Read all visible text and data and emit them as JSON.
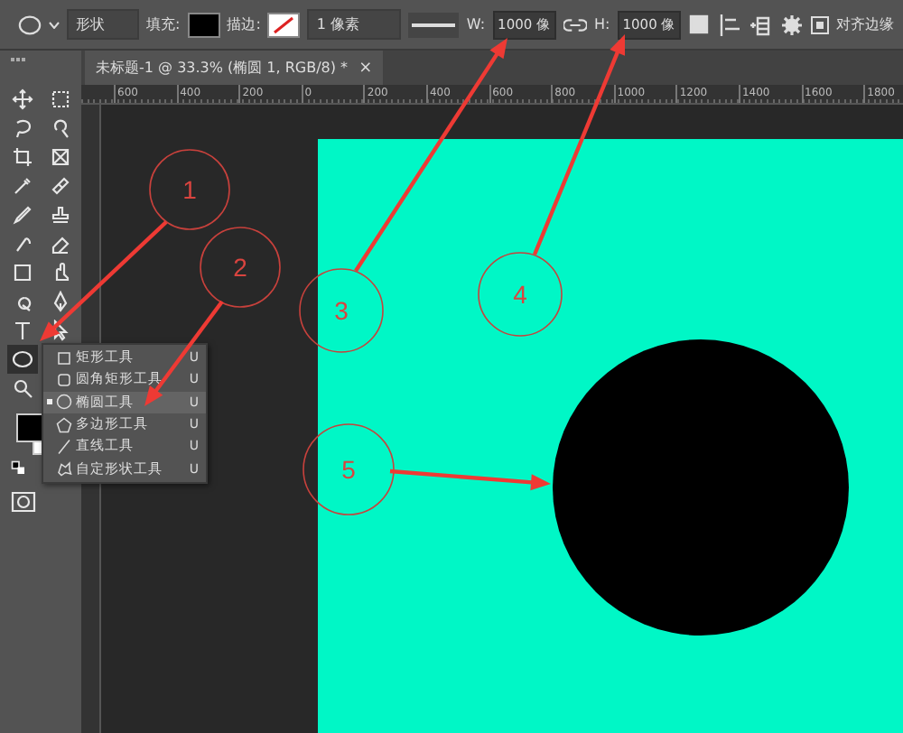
{
  "options_bar": {
    "shape_mode": "形状",
    "fill_label": "填充:",
    "stroke_label": "描边:",
    "stroke_width": "1 像素",
    "w_label": "W:",
    "w_value": "1000 像",
    "h_label": "H:",
    "h_value": "1000 像",
    "align_edges": {
      "label": "对齐边缘",
      "checked": true
    }
  },
  "document_tab": {
    "title": "未标题-1 @ 33.3% (椭圆 1, RGB/8) *",
    "close": "×"
  },
  "ruler": {
    "ticks": [
      "600",
      "400",
      "200",
      "0",
      "200",
      "400",
      "600",
      "800",
      "1000",
      "1200",
      "1400",
      "1600",
      "1800"
    ]
  },
  "shape_menu": [
    {
      "kind": "rect",
      "label": "矩形工具",
      "shortcut": "U",
      "selected": false
    },
    {
      "kind": "rounded",
      "label": "圆角矩形工具",
      "shortcut": "U",
      "selected": false
    },
    {
      "kind": "ellipse",
      "label": "椭圆工具",
      "shortcut": "U",
      "selected": true
    },
    {
      "kind": "polygon",
      "label": "多边形工具",
      "shortcut": "U",
      "selected": false
    },
    {
      "kind": "line",
      "label": "直线工具",
      "shortcut": "U",
      "selected": false
    },
    {
      "kind": "custom",
      "label": "自定形状工具",
      "shortcut": "U",
      "selected": false
    }
  ],
  "annotations": [
    {
      "label": "1"
    },
    {
      "label": "2"
    },
    {
      "label": "3"
    },
    {
      "label": "4"
    },
    {
      "label": "5"
    }
  ]
}
